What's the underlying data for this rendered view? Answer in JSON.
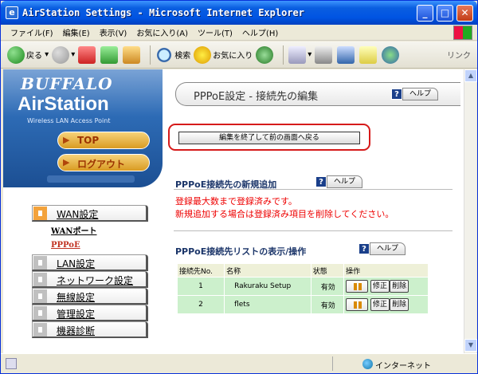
{
  "window": {
    "title": "AirStation Settings - Microsoft Internet Explorer",
    "title_icon": "ie-icon",
    "min_icon": "_",
    "max_icon": "□",
    "close_icon": "✕"
  },
  "menu": {
    "items": [
      "ファイル(F)",
      "編集(E)",
      "表示(V)",
      "お気に入り(A)",
      "ツール(T)",
      "ヘルプ(H)"
    ]
  },
  "toolbar": {
    "back_label": "戻る",
    "search_label": "検索",
    "favorites_label": "お気に入り",
    "links_label": "リンク"
  },
  "sidebar": {
    "brand_line1": "BUFFALO",
    "brand_line2": "AirStation",
    "brand_line3": "Wireless LAN Access Point",
    "top_label": "TOP",
    "logout_label": "ログアウト",
    "nav": [
      {
        "label": "WAN設定",
        "active": true
      },
      {
        "label": "LAN設定",
        "active": false
      },
      {
        "label": "ネットワーク設定",
        "active": false
      },
      {
        "label": "無線設定",
        "active": false
      },
      {
        "label": "管理設定",
        "active": false
      },
      {
        "label": "機器診断",
        "active": false
      }
    ],
    "sub_wan_port": "WANポート",
    "sub_pppoe": "PPPoE"
  },
  "content": {
    "page_title": "PPPoE設定 - 接続先の編集",
    "help_label": "ヘルプ",
    "back_button": "編集を終了して前の画面へ戻る",
    "add_section_title": "PPPoE接続先の新規追加",
    "msg_line1": "登録最大数まで登録済みです。",
    "msg_line2": "新規追加する場合は登録済み項目を削除してください。",
    "list_section_title": "PPPoE接続先リストの表示/操作",
    "columns": [
      "接続先No.",
      "名称",
      "状態",
      "操作"
    ],
    "rows": [
      {
        "no": "1",
        "name": "Rakuraku Setup",
        "status": "有効",
        "edit": "修正",
        "delete": "削除"
      },
      {
        "no": "2",
        "name": "flets",
        "status": "有効",
        "edit": "修正",
        "delete": "削除"
      }
    ]
  },
  "statusbar": {
    "zone": "インターネット"
  },
  "colors": {
    "title_blue": "#0054e3",
    "alert_red": "#e00000",
    "row_green": "#ccf0cc",
    "accent_orange": "#f3a23b"
  }
}
